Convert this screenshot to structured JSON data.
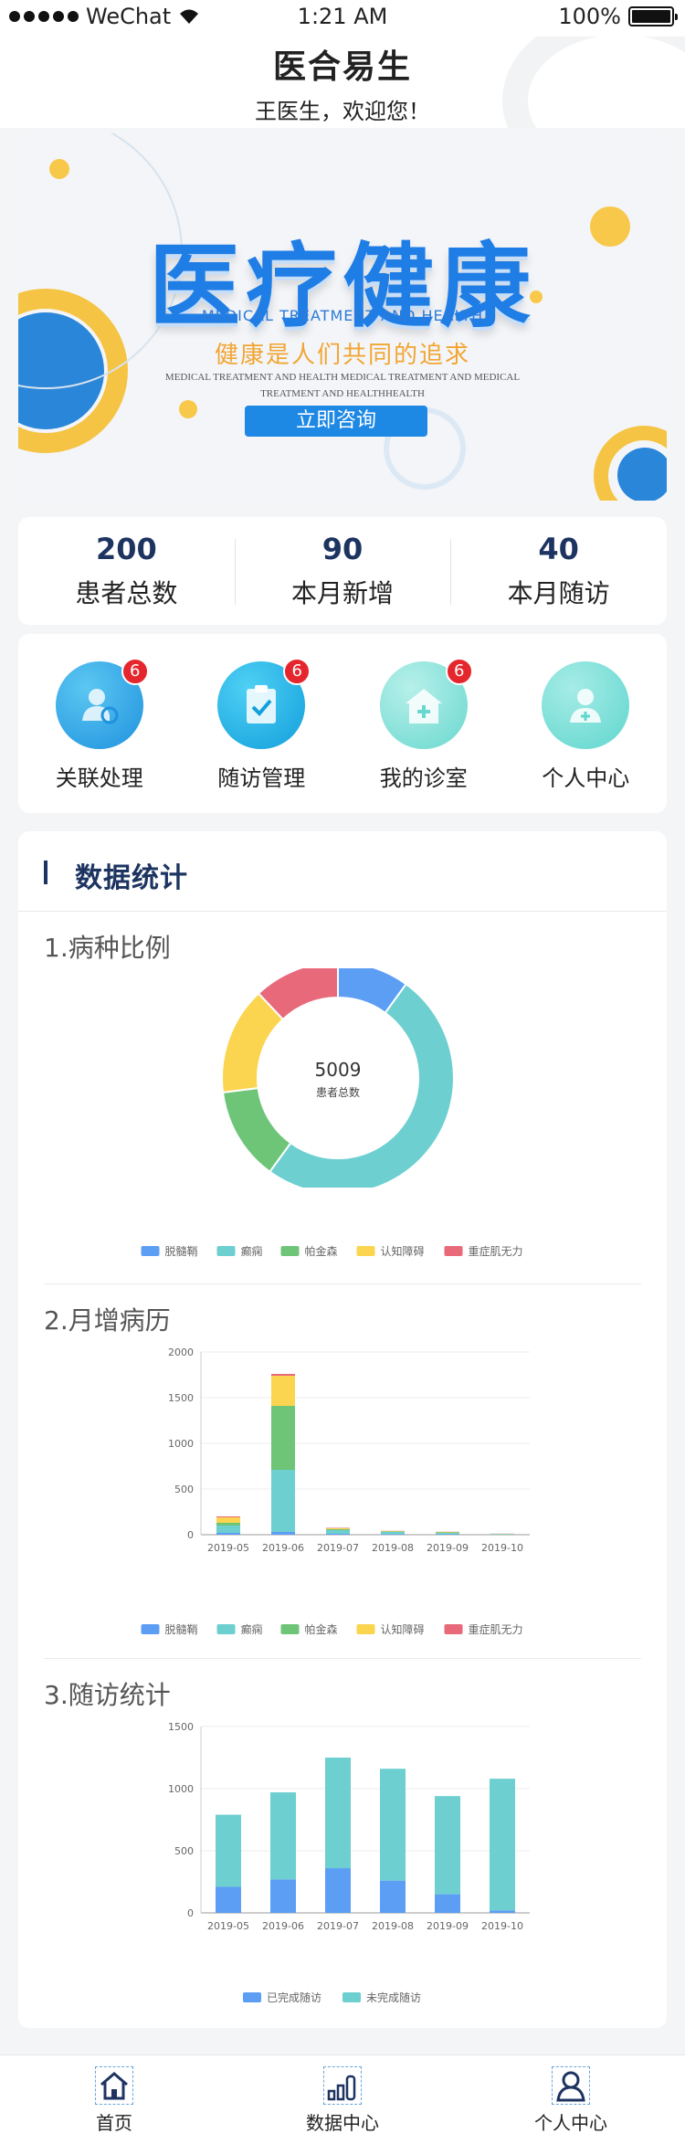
{
  "status_bar": {
    "carrier": "WeChat",
    "time": "1:21 AM",
    "battery": "100%"
  },
  "header": {
    "title": "医合易生",
    "welcome": "王医生，欢迎您！"
  },
  "banner": {
    "title": "医疗健康",
    "subtitle": "MEDICAL TREATMENT AND HEALTH",
    "slogan": "健康是人们共同的追求",
    "small_text": "MEDICAL TREATMENT AND HEALTH MEDICAL TREATMENT AND MEDICAL TREATMENT AND HEALTHHEALTH",
    "button": "立即咨询"
  },
  "stats": [
    {
      "value": "200",
      "label": "患者总数"
    },
    {
      "value": "90",
      "label": "本月新增"
    },
    {
      "value": "40",
      "label": "本月随访"
    }
  ],
  "menu": [
    {
      "label": "关联处理",
      "badge": "6",
      "icon": "link-user-icon",
      "color": "#2ea9e6"
    },
    {
      "label": "随访管理",
      "badge": "6",
      "icon": "clipboard-check-icon",
      "color": "#22b5e8"
    },
    {
      "label": "我的诊室",
      "badge": "6",
      "icon": "clinic-house-icon",
      "color": "#7fe0d8"
    },
    {
      "label": "个人中心",
      "badge": "",
      "icon": "user-plus-icon",
      "color": "#6fdcd5"
    }
  ],
  "data_section": {
    "title": "数据统计",
    "sections": [
      "1.病种比例",
      "2.月增病历",
      "3.随访统计"
    ]
  },
  "colors": {
    "blue": "#5b9ef4",
    "teal": "#6dcfd0",
    "green": "#6ec578",
    "yellow": "#fbd54f",
    "red": "#e8697a",
    "navy": "#1d3461"
  },
  "chart_data": [
    {
      "type": "pie",
      "center_value": "5009",
      "center_label": "患者总数",
      "legend": [
        "脱髓鞘",
        "癫痫",
        "帕金森",
        "认知障碍",
        "重症肌无力"
      ],
      "values": [
        10,
        50,
        13,
        15,
        12
      ],
      "colors": [
        "#5b9ef4",
        "#6dcfd0",
        "#6ec578",
        "#fbd54f",
        "#e8697a"
      ]
    },
    {
      "type": "bar",
      "stacked": true,
      "categories": [
        "2019-05",
        "2019-06",
        "2019-07",
        "2019-08",
        "2019-09",
        "2019-10"
      ],
      "ylim": [
        0,
        2000
      ],
      "yticks": [
        0,
        500,
        1000,
        1500,
        2000
      ],
      "series": [
        {
          "name": "脱髓鞘",
          "values": [
            20,
            30,
            10,
            5,
            5,
            2
          ]
        },
        {
          "name": "癫痫",
          "values": [
            80,
            680,
            40,
            25,
            15,
            5
          ]
        },
        {
          "name": "帕金森",
          "values": [
            30,
            700,
            10,
            5,
            5,
            2
          ]
        },
        {
          "name": "认知障碍",
          "values": [
            60,
            330,
            10,
            5,
            5,
            2
          ]
        },
        {
          "name": "重症肌无力",
          "values": [
            10,
            20,
            5,
            2,
            2,
            1
          ]
        }
      ]
    },
    {
      "type": "bar",
      "stacked": true,
      "categories": [
        "2019-05",
        "2019-06",
        "2019-07",
        "2019-08",
        "2019-09",
        "2019-10"
      ],
      "ylim": [
        0,
        1500
      ],
      "yticks": [
        0,
        500,
        1000,
        1500
      ],
      "series": [
        {
          "name": "已完成随访",
          "values": [
            210,
            270,
            360,
            260,
            150,
            20
          ]
        },
        {
          "name": "未完成随访",
          "values": [
            580,
            700,
            890,
            900,
            790,
            1060
          ]
        }
      ]
    }
  ],
  "tabs": [
    {
      "label": "首页",
      "icon": "home-icon"
    },
    {
      "label": "数据中心",
      "icon": "bar-chart-icon"
    },
    {
      "label": "个人中心",
      "icon": "user-icon"
    }
  ]
}
